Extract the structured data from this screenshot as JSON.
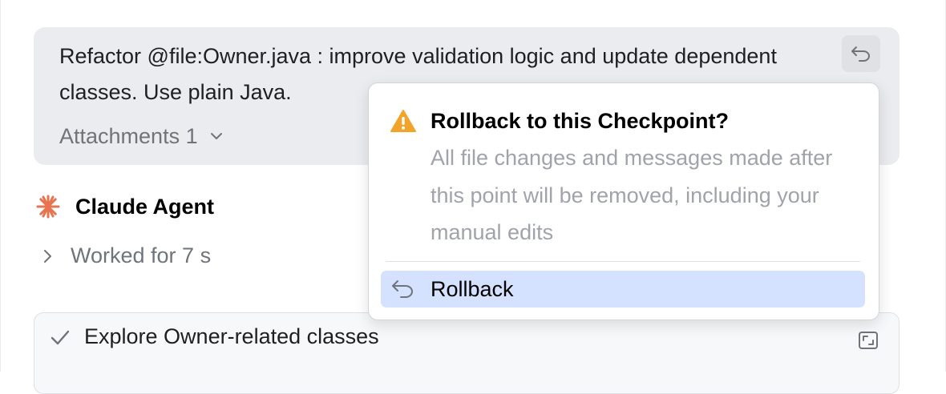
{
  "prompt": {
    "text": "Refactor @file:Owner.java : improve validation logic and update dependent classes. Use plain Java.",
    "attachments_label": "Attachments 1",
    "attachments_icon": "chevron-down-icon",
    "rollback_icon": "undo-icon"
  },
  "agent": {
    "name": "Claude Agent",
    "icon": "claude-sparkle-icon",
    "brand_color": "#e8744f"
  },
  "worked": {
    "label": "Worked for 7 s",
    "icon": "chevron-right-icon"
  },
  "task": {
    "label": "Explore Owner-related classes",
    "status_icon": "check-icon",
    "expand_icon": "expand-icon"
  },
  "popup": {
    "icon": "warning-icon",
    "warning_color": "#f2a32a",
    "title": "Rollback to this Checkpoint?",
    "description": "All file changes and messages made after this point will be removed, including your manual edits",
    "action_label": "Rollback",
    "action_icon": "undo-icon",
    "action_highlight": "#d4e2ff"
  }
}
